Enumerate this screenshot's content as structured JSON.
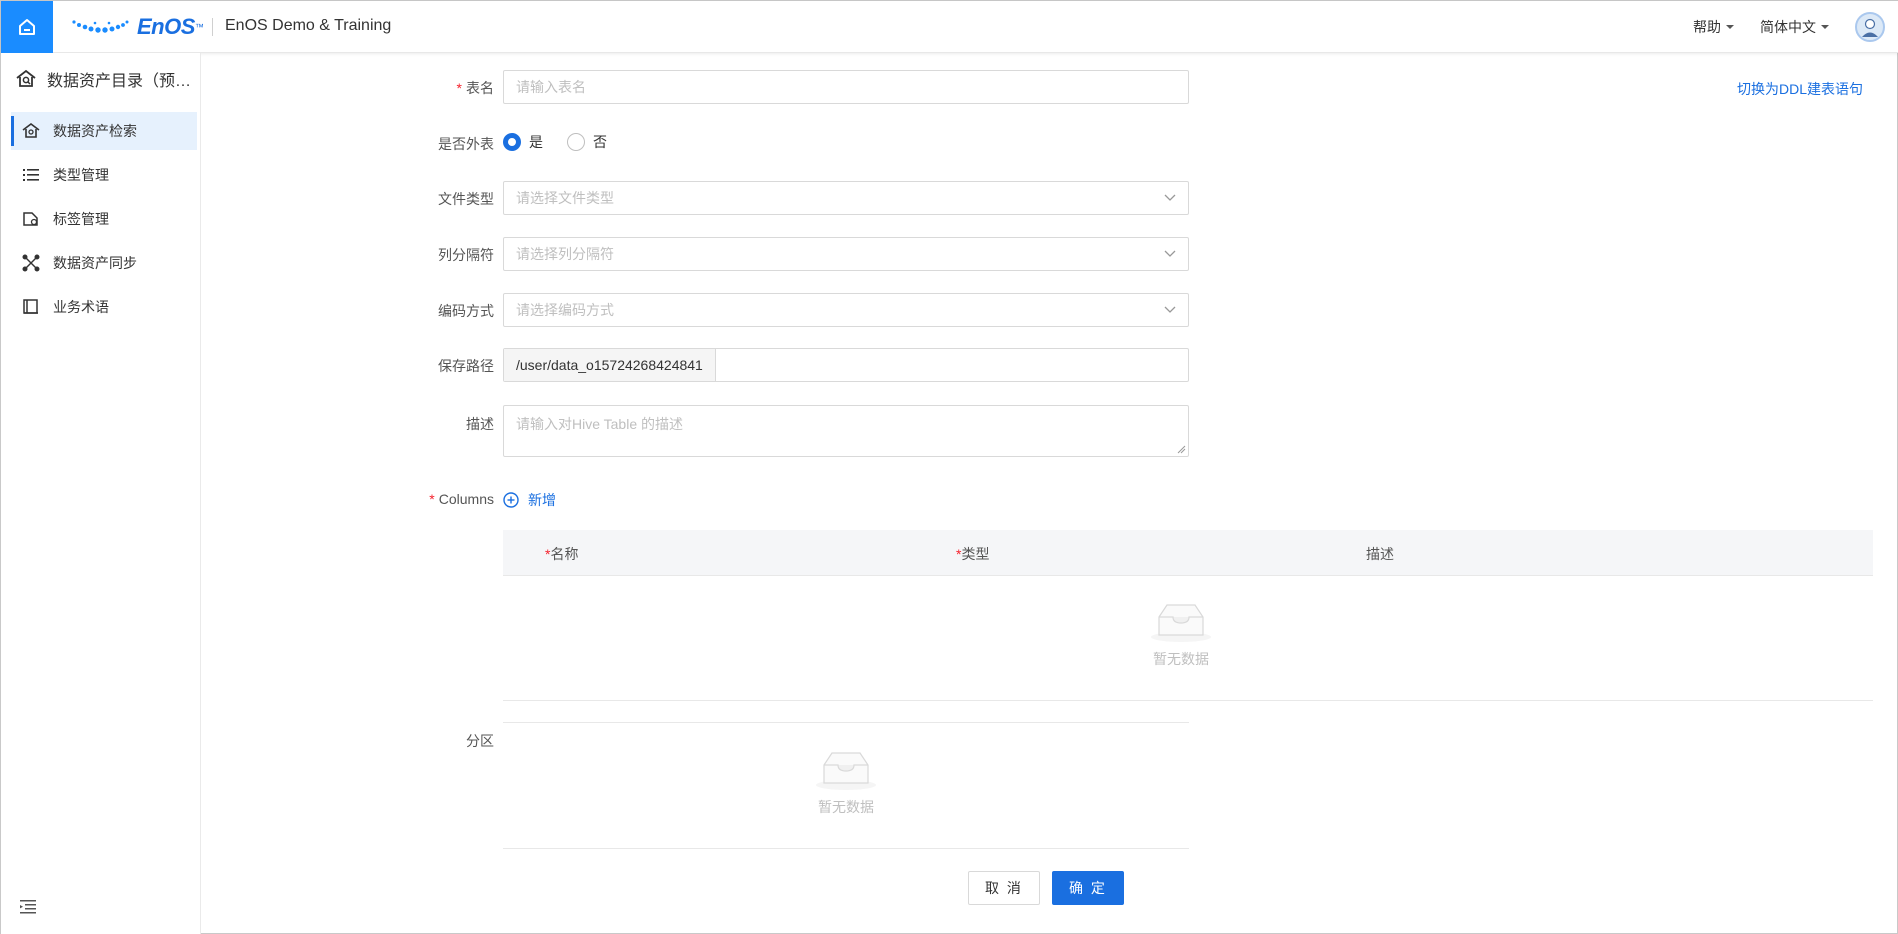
{
  "header": {
    "brand": "EnOS",
    "org_name": "EnOS Demo & Training",
    "help": "帮助",
    "language": "简体中文"
  },
  "sidebar": {
    "title": "数据资产目录（预…",
    "items": [
      {
        "label": "数据资产检索",
        "icon": "house-search-icon",
        "active": true
      },
      {
        "label": "类型管理",
        "icon": "list-icon",
        "active": false
      },
      {
        "label": "标签管理",
        "icon": "tag-icon",
        "active": false
      },
      {
        "label": "数据资产同步",
        "icon": "share-nodes-icon",
        "active": false
      },
      {
        "label": "业务术语",
        "icon": "book-icon",
        "active": false
      }
    ]
  },
  "form": {
    "ddl_link": "切换为DDL建表语句",
    "table_name": {
      "label": "表名",
      "placeholder": "请输入表名"
    },
    "external": {
      "label": "是否外表",
      "yes": "是",
      "no": "否",
      "selected": "是"
    },
    "file_type": {
      "label": "文件类型",
      "placeholder": "请选择文件类型"
    },
    "separator": {
      "label": "列分隔符",
      "placeholder": "请选择列分隔符"
    },
    "encoding": {
      "label": "编码方式",
      "placeholder": "请选择编码方式"
    },
    "save_path": {
      "label": "保存路径",
      "prefix": "/user/data_o15724268424841",
      "value": ""
    },
    "description": {
      "label": "描述",
      "placeholder": "请输入对Hive Table 的描述"
    },
    "columns": {
      "label": "Columns",
      "add": "新增",
      "headers": {
        "name": "名称",
        "type": "类型",
        "desc": "描述"
      },
      "empty": "暂无数据"
    },
    "partition": {
      "label": "分区",
      "empty": "暂无数据"
    },
    "cancel": "取 消",
    "ok": "确 定"
  },
  "colors": {
    "accent": "#1a6fe0",
    "home": "#1a8cff",
    "required": "#f5222d"
  }
}
